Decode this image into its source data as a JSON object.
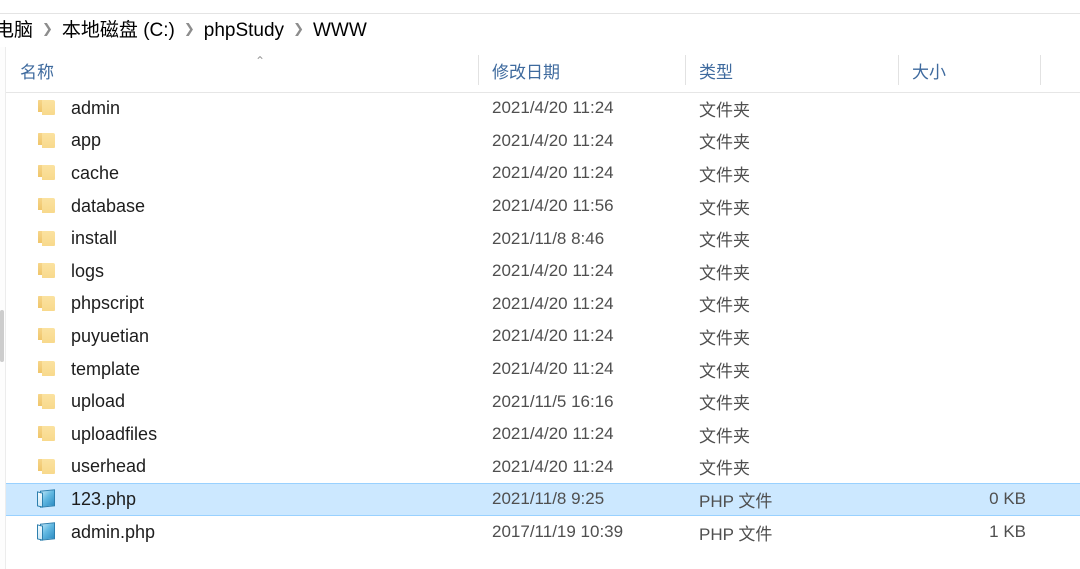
{
  "window": {
    "app": "File Explorer"
  },
  "breadcrumb": {
    "separator": "❯",
    "items": [
      {
        "label": "电脑"
      },
      {
        "label": "本地磁盘 (C:)"
      },
      {
        "label": "phpStudy"
      },
      {
        "label": "WWW"
      }
    ]
  },
  "columns": {
    "name": "名称",
    "date_modified": "修改日期",
    "type": "类型",
    "size": "大小",
    "sort_indicator": "⌃",
    "sorted_by": "名称",
    "sort_direction": "ascending"
  },
  "colors": {
    "header_text": "#3e6a9e",
    "selection_fill": "#cce8ff",
    "selection_border": "#99d1ff",
    "folder_icon": "#f8d98c",
    "php_icon": "#63b9e2",
    "row_text": "#1d1d1d",
    "meta_text": "#4f4f4f"
  },
  "rows": [
    {
      "icon": "folder-icon",
      "name": "admin",
      "date": "2021/4/20 11:24",
      "type": "文件夹",
      "size": "",
      "selected": false
    },
    {
      "icon": "folder-icon",
      "name": "app",
      "date": "2021/4/20 11:24",
      "type": "文件夹",
      "size": "",
      "selected": false
    },
    {
      "icon": "folder-icon",
      "name": "cache",
      "date": "2021/4/20 11:24",
      "type": "文件夹",
      "size": "",
      "selected": false
    },
    {
      "icon": "folder-icon",
      "name": "database",
      "date": "2021/4/20 11:56",
      "type": "文件夹",
      "size": "",
      "selected": false
    },
    {
      "icon": "folder-icon",
      "name": "install",
      "date": "2021/11/8 8:46",
      "type": "文件夹",
      "size": "",
      "selected": false
    },
    {
      "icon": "folder-icon",
      "name": "logs",
      "date": "2021/4/20 11:24",
      "type": "文件夹",
      "size": "",
      "selected": false
    },
    {
      "icon": "folder-icon",
      "name": "phpscript",
      "date": "2021/4/20 11:24",
      "type": "文件夹",
      "size": "",
      "selected": false
    },
    {
      "icon": "folder-icon",
      "name": "puyuetian",
      "date": "2021/4/20 11:24",
      "type": "文件夹",
      "size": "",
      "selected": false
    },
    {
      "icon": "folder-icon",
      "name": "template",
      "date": "2021/4/20 11:24",
      "type": "文件夹",
      "size": "",
      "selected": false
    },
    {
      "icon": "folder-icon",
      "name": "upload",
      "date": "2021/11/5 16:16",
      "type": "文件夹",
      "size": "",
      "selected": false
    },
    {
      "icon": "folder-icon",
      "name": "uploadfiles",
      "date": "2021/4/20 11:24",
      "type": "文件夹",
      "size": "",
      "selected": false
    },
    {
      "icon": "folder-icon",
      "name": "userhead",
      "date": "2021/4/20 11:24",
      "type": "文件夹",
      "size": "",
      "selected": false
    },
    {
      "icon": "php-icon",
      "name": "123.php",
      "date": "2021/11/8 9:25",
      "type": "PHP 文件",
      "size": "0 KB",
      "selected": true
    },
    {
      "icon": "php-icon",
      "name": "admin.php",
      "date": "2017/11/19 10:39",
      "type": "PHP 文件",
      "size": "1 KB",
      "selected": false
    }
  ]
}
